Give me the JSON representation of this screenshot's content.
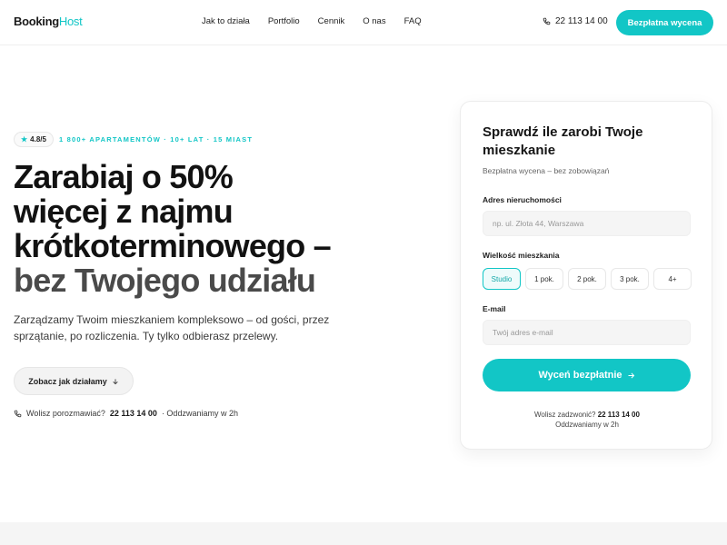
{
  "brand": {
    "name_part1": "Booking",
    "name_part2": "Host",
    "accent_color": "#12c6c6"
  },
  "nav": {
    "links": [
      "Jak to działa",
      "Portfolio",
      "Cennik",
      "O nas",
      "FAQ"
    ],
    "phone": "22 113 14 00",
    "cta": "Bezpłatna wycena"
  },
  "hero": {
    "rating": "4.8/5",
    "badge": "1 800+ APARTAMENTÓW · 10+ LAT · 15 MIAST",
    "title_line1": "Zarabiaj o 50%",
    "title_line2": "więcej z najmu",
    "title_line3": "krótkoterminowego –",
    "title_line4": "bez Twojego udziału",
    "description": "Zarządzamy Twoim mieszkaniem kompleksowo – od gości, przez sprzątanie, po rozliczenia. Ty tylko odbierasz przelewy.",
    "secondary_button": "Zobacz jak działamy",
    "contact_prefix": "Wolisz porozmawiać?",
    "contact_phone": "22 113 14 00",
    "contact_suffix": "· Oddzwaniamy w 2h"
  },
  "form": {
    "title": "Sprawdź ile zarobi Twoje mieszkanie",
    "subtitle": "Bezpłatna wycena – bez zobowiązań",
    "address_label": "Adres nieruchomości",
    "address_placeholder": "np. ul. Złota 44, Warszawa",
    "size_label": "Wielkość mieszkania",
    "sizes": [
      "Studio",
      "1 pok.",
      "2 pok.",
      "3 pok.",
      "4+"
    ],
    "selected_size": "Studio",
    "email_label": "E-mail",
    "email_placeholder": "Twój adres e-mail",
    "submit": "Wyceń bezpłatnie",
    "foot_prefix": "Wolisz zadzwonić?",
    "foot_phone": "22 113 14 00",
    "foot_line2": "Oddzwaniamy w 2h"
  },
  "icons": {
    "phone": "phone-icon",
    "star": "star-icon",
    "arrow_down": "arrow-down-icon",
    "arrow_right": "arrow-right-icon"
  }
}
